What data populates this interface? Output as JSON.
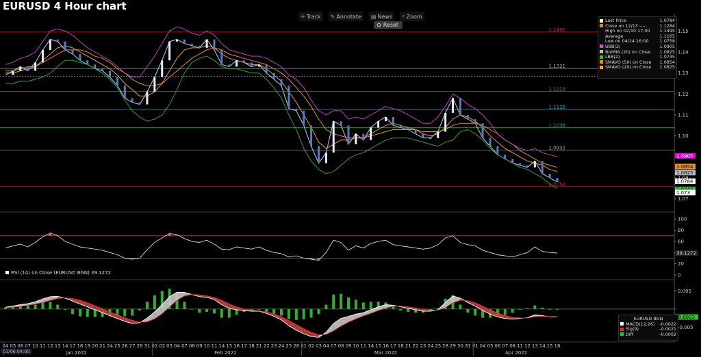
{
  "title": "EURUSD 4 Hour chart",
  "toolbar": {
    "track": "Track",
    "annotate": "Annotate",
    "news": "News",
    "zoom": "Zoom",
    "reset": "Reset"
  },
  "date_box": "01/06 04:00",
  "legend": [
    {
      "label": "Last Price",
      "value": "1.0784",
      "color": "#ffffff"
    },
    {
      "label": "Close on 12/13 ----",
      "value": "1.1284",
      "color": "#e08020"
    },
    {
      "label": "High on 02/10 17:00",
      "value": "1.1495",
      "color": ""
    },
    {
      "label": "Average",
      "value": "1.1165",
      "color": ""
    },
    {
      "label": "Low on 04/14 16:00",
      "value": "1.0758",
      "color": ""
    },
    {
      "label": "UBB(2)",
      "value": "1.0905",
      "color": "#e040e0"
    },
    {
      "label": "BollMA (20)  on Close",
      "value": "1.0825",
      "color": "#bbbbbb"
    },
    {
      "label": "LBB(2)",
      "value": "1.0745",
      "color": "#30c030"
    },
    {
      "label": "SMAVG (50)  on Close",
      "value": "1.0854",
      "color": "#e09030"
    },
    {
      "label": "SMAVG (20)  on Close",
      "value": "1.0825",
      "color": "#e8a040"
    }
  ],
  "rsi_legend": "RSI (14)  on Close (EURUSD BGN) 39.1272",
  "macd_legend": {
    "header": "EURUSD BGN",
    "rows": [
      {
        "label": "MACD(12,26)",
        "value": "-0.0022",
        "color": "#ffffff"
      },
      {
        "label": "Sig(9)",
        "value": "-0.0021",
        "color": "#e03030"
      },
      {
        "label": "Diff",
        "value": "-0.0002",
        "color": "#30c030"
      }
    ]
  },
  "chart_data": [
    {
      "type": "line",
      "title": "EURUSD 4 Hour chart",
      "y_axis_ticks": [
        1.15,
        1.14,
        1.13,
        1.12,
        1.11,
        1.1,
        1.09,
        1.08,
        1.07
      ],
      "ylim": [
        1.065,
        1.155
      ],
      "date_ticks": [
        "04",
        "05",
        "06",
        "07",
        "10",
        "11",
        "12",
        "13",
        "14",
        "17",
        "18",
        "19",
        "20",
        "21",
        "24",
        "25",
        "26",
        "27",
        "28",
        "31",
        "01",
        "02",
        "03",
        "04",
        "07",
        "08",
        "09",
        "10",
        "11",
        "14",
        "15",
        "16",
        "17",
        "18",
        "21",
        "22",
        "23",
        "24",
        "25",
        "28",
        "01",
        "02",
        "03",
        "04",
        "07",
        "08",
        "09",
        "10",
        "11",
        "14",
        "15",
        "16",
        "17",
        "18",
        "21",
        "22",
        "23",
        "24",
        "25",
        "28",
        "29",
        "30",
        "31",
        "01",
        "04",
        "05",
        "06",
        "07",
        "08",
        "11",
        "12",
        "13",
        "14",
        "15",
        "18"
      ],
      "months": [
        "Jan 2022",
        "Feb 2022",
        "Mar 2022",
        "Apr 2022"
      ],
      "horizontal_levels": [
        {
          "label": "1.1495",
          "value": 1.1495,
          "color": "#c03030"
        },
        {
          "label": "1.1321",
          "value": 1.1321,
          "color": "#888888"
        },
        {
          "label": "1.1213",
          "value": 1.1213,
          "color": "#30a030"
        },
        {
          "label": "1.1126",
          "value": 1.1126,
          "color": "#40a0c0"
        },
        {
          "label": "1.1039",
          "value": 1.1039,
          "color": "#30a030"
        },
        {
          "label": "1.0932",
          "value": 1.0932,
          "color": "#888888"
        },
        {
          "label": "1.0758",
          "value": 1.0758,
          "color": "#c03030"
        }
      ],
      "close_line": 1.1284,
      "right_labels": [
        {
          "label": "1.0905",
          "value": 1.0905,
          "bg": "#e000e0",
          "fg": "#ffffff"
        },
        {
          "label": "1.0854",
          "value": 1.0854,
          "bg": "#e09030",
          "fg": "#000000"
        },
        {
          "label": "1.0825",
          "value": 1.0825,
          "bg": "#bbbbbb",
          "fg": "#000000"
        },
        {
          "label": "1.0784",
          "value": 1.0784,
          "bg": "#ffffff",
          "fg": "#000000"
        },
        {
          "label": "1.0745",
          "value": 1.0745,
          "bg": "#30c030",
          "fg": "#000000"
        },
        {
          "label": "1.073",
          "value": 1.073,
          "bg": "#ffffff",
          "fg": "#000000"
        }
      ],
      "series": [
        {
          "name": "Last Price",
          "color": "#9ab8d8",
          "values": [
            1.129,
            1.131,
            1.133,
            1.131,
            1.135,
            1.141,
            1.146,
            1.145,
            1.141,
            1.139,
            1.136,
            1.134,
            1.132,
            1.131,
            1.128,
            1.124,
            1.118,
            1.116,
            1.115,
            1.121,
            1.128,
            1.136,
            1.145,
            1.146,
            1.144,
            1.143,
            1.142,
            1.146,
            1.141,
            1.134,
            1.133,
            1.136,
            1.135,
            1.133,
            1.134,
            1.13,
            1.127,
            1.124,
            1.113,
            1.112,
            1.105,
            1.095,
            1.087,
            1.092,
            1.107,
            1.105,
            1.096,
            1.101,
            1.098,
            1.104,
            1.107,
            1.109,
            1.105,
            1.104,
            1.103,
            1.101,
            1.099,
            1.099,
            1.102,
            1.111,
            1.118,
            1.11,
            1.108,
            1.106,
            1.099,
            1.095,
            1.091,
            1.089,
            1.087,
            1.086,
            1.085,
            1.088,
            1.082,
            1.08,
            1.078
          ]
        },
        {
          "name": "SMAVG (50)  on Close",
          "color": "#e09030",
          "values": [
            1.131,
            1.131,
            1.132,
            1.133,
            1.133,
            1.135,
            1.137,
            1.139,
            1.141,
            1.141,
            1.141,
            1.14,
            1.138,
            1.137,
            1.135,
            1.132,
            1.13,
            1.127,
            1.125,
            1.124,
            1.124,
            1.125,
            1.128,
            1.131,
            1.134,
            1.137,
            1.139,
            1.141,
            1.142,
            1.141,
            1.139,
            1.138,
            1.137,
            1.136,
            1.135,
            1.134,
            1.132,
            1.13,
            1.127,
            1.123,
            1.119,
            1.114,
            1.108,
            1.103,
            1.101,
            1.1,
            1.099,
            1.099,
            1.099,
            1.1,
            1.101,
            1.102,
            1.103,
            1.103,
            1.103,
            1.103,
            1.102,
            1.102,
            1.102,
            1.103,
            1.105,
            1.106,
            1.106,
            1.106,
            1.105,
            1.103,
            1.101,
            1.098,
            1.096,
            1.093,
            1.091,
            1.089,
            1.087,
            1.086,
            1.085
          ]
        },
        {
          "name": "SMAVG (20)  on Close",
          "color": "#e8a040",
          "values": [
            1.13,
            1.13,
            1.131,
            1.132,
            1.133,
            1.136,
            1.139,
            1.142,
            1.143,
            1.142,
            1.14,
            1.138,
            1.136,
            1.134,
            1.132,
            1.129,
            1.125,
            1.122,
            1.119,
            1.119,
            1.121,
            1.125,
            1.131,
            1.137,
            1.141,
            1.142,
            1.142,
            1.143,
            1.142,
            1.139,
            1.137,
            1.136,
            1.135,
            1.134,
            1.134,
            1.132,
            1.129,
            1.126,
            1.121,
            1.116,
            1.11,
            1.104,
            1.097,
            1.094,
            1.096,
            1.098,
            1.098,
            1.099,
            1.099,
            1.101,
            1.103,
            1.105,
            1.106,
            1.105,
            1.104,
            1.103,
            1.101,
            1.1,
            1.101,
            1.104,
            1.108,
            1.11,
            1.109,
            1.107,
            1.104,
            1.1,
            1.097,
            1.094,
            1.092,
            1.09,
            1.088,
            1.087,
            1.086,
            1.084,
            1.083
          ]
        },
        {
          "name": "UBB(2)",
          "color": "#c040c0",
          "values": [
            1.134,
            1.135,
            1.137,
            1.138,
            1.14,
            1.145,
            1.15,
            1.151,
            1.15,
            1.148,
            1.145,
            1.142,
            1.14,
            1.138,
            1.136,
            1.133,
            1.13,
            1.128,
            1.128,
            1.133,
            1.138,
            1.144,
            1.15,
            1.152,
            1.151,
            1.149,
            1.148,
            1.15,
            1.148,
            1.144,
            1.141,
            1.14,
            1.139,
            1.138,
            1.138,
            1.137,
            1.135,
            1.133,
            1.129,
            1.127,
            1.123,
            1.117,
            1.112,
            1.11,
            1.112,
            1.112,
            1.108,
            1.109,
            1.108,
            1.11,
            1.112,
            1.114,
            1.113,
            1.112,
            1.11,
            1.108,
            1.106,
            1.106,
            1.109,
            1.114,
            1.12,
            1.118,
            1.115,
            1.113,
            1.11,
            1.106,
            1.101,
            1.098,
            1.096,
            1.094,
            1.093,
            1.094,
            1.092,
            1.091,
            1.09
          ]
        },
        {
          "name": "LBB(2)",
          "color": "#30a030",
          "values": [
            1.125,
            1.125,
            1.126,
            1.126,
            1.127,
            1.128,
            1.13,
            1.133,
            1.136,
            1.136,
            1.135,
            1.134,
            1.132,
            1.13,
            1.127,
            1.123,
            1.117,
            1.112,
            1.109,
            1.107,
            1.108,
            1.11,
            1.115,
            1.122,
            1.13,
            1.135,
            1.137,
            1.138,
            1.136,
            1.133,
            1.132,
            1.132,
            1.131,
            1.13,
            1.13,
            1.127,
            1.123,
            1.118,
            1.11,
            1.103,
            1.094,
            1.088,
            1.084,
            1.082,
            1.083,
            1.086,
            1.089,
            1.091,
            1.092,
            1.094,
            1.096,
            1.098,
            1.099,
            1.099,
            1.099,
            1.098,
            1.097,
            1.096,
            1.095,
            1.097,
            1.098,
            1.102,
            1.103,
            1.101,
            1.098,
            1.094,
            1.091,
            1.089,
            1.087,
            1.085,
            1.084,
            1.082,
            1.08,
            1.077,
            1.075
          ]
        }
      ]
    },
    {
      "type": "line",
      "title": "RSI (14)  on Close (EURUSD BGN) 39.1272",
      "y_axis_ticks": [
        100,
        80,
        60,
        40,
        20,
        0
      ],
      "ylim": [
        -5,
        110
      ],
      "bands": [
        70,
        30
      ],
      "last_label": "39.1272",
      "series": [
        {
          "name": "RSI (14)",
          "color": "#dddddd",
          "values": [
            48,
            52,
            55,
            50,
            58,
            68,
            75,
            70,
            60,
            55,
            50,
            48,
            46,
            44,
            40,
            36,
            30,
            28,
            30,
            45,
            58,
            66,
            74,
            72,
            65,
            60,
            58,
            62,
            55,
            46,
            45,
            50,
            48,
            46,
            50,
            44,
            40,
            38,
            32,
            34,
            30,
            28,
            26,
            40,
            62,
            58,
            44,
            52,
            48,
            56,
            60,
            62,
            54,
            52,
            50,
            48,
            46,
            48,
            54,
            66,
            70,
            58,
            54,
            52,
            44,
            40,
            36,
            34,
            32,
            36,
            40,
            50,
            42,
            40,
            39
          ]
        }
      ]
    },
    {
      "type": "bar",
      "title": "MACD",
      "y_axis_ticks": [
        0.005,
        0,
        -0.005
      ],
      "ylim": [
        -0.0085,
        0.0075
      ],
      "last_label": "-0.0022",
      "series": [
        {
          "name": "MACD(12,26)",
          "color": "#ffffff",
          "values": [
            0.0005,
            0.0008,
            0.0012,
            0.0015,
            0.002,
            0.0028,
            0.0034,
            0.0035,
            0.003,
            0.0022,
            0.0014,
            0.0006,
            -0.0002,
            -0.001,
            -0.0018,
            -0.0026,
            -0.0034,
            -0.004,
            -0.0038,
            -0.0025,
            -0.0008,
            0.0012,
            0.0034,
            0.0046,
            0.0046,
            0.004,
            0.0034,
            0.0032,
            0.0026,
            0.0012,
            0.0002,
            -0.0002,
            -0.0004,
            -0.0006,
            -0.0006,
            -0.0012,
            -0.002,
            -0.003,
            -0.0046,
            -0.0058,
            -0.0068,
            -0.0076,
            -0.0078,
            -0.0064,
            -0.004,
            -0.0026,
            -0.002,
            -0.0014,
            -0.001,
            -0.0002,
            0.0006,
            0.0012,
            0.001,
            0.0006,
            0.0002,
            -0.0002,
            -0.0006,
            -0.0006,
            -0.0002,
            0.0018,
            0.0036,
            0.003,
            0.0018,
            0.0008,
            -0.0004,
            -0.0014,
            -0.0022,
            -0.0026,
            -0.0028,
            -0.0026,
            -0.0024,
            -0.0016,
            -0.0018,
            -0.0022,
            -0.0022
          ]
        },
        {
          "name": "Sig(9)",
          "color": "#e03030",
          "values": [
            0.0003,
            0.0005,
            0.0007,
            0.001,
            0.0014,
            0.0018,
            0.0024,
            0.0029,
            0.0031,
            0.0029,
            0.0024,
            0.0017,
            0.0009,
            0.0001,
            -0.0008,
            -0.0016,
            -0.0024,
            -0.0031,
            -0.0036,
            -0.0035,
            -0.0027,
            -0.0013,
            0.0006,
            0.0024,
            0.0036,
            0.004,
            0.0039,
            0.0036,
            0.0032,
            0.0024,
            0.0014,
            0.0006,
            0.0,
            -0.0003,
            -0.0005,
            -0.0008,
            -0.0013,
            -0.0021,
            -0.0032,
            -0.0043,
            -0.0054,
            -0.0064,
            -0.0071,
            -0.007,
            -0.006,
            -0.0047,
            -0.0036,
            -0.0027,
            -0.0019,
            -0.0012,
            -0.0004,
            0.0003,
            0.0007,
            0.0008,
            0.0006,
            0.0003,
            -0.0001,
            -0.0003,
            -0.0003,
            0.0004,
            0.0017,
            0.0024,
            0.0023,
            0.0017,
            0.0008,
            -0.0002,
            -0.0011,
            -0.0018,
            -0.0023,
            -0.0025,
            -0.0025,
            -0.0021,
            -0.002,
            -0.0021,
            -0.0021
          ]
        }
      ]
    }
  ]
}
